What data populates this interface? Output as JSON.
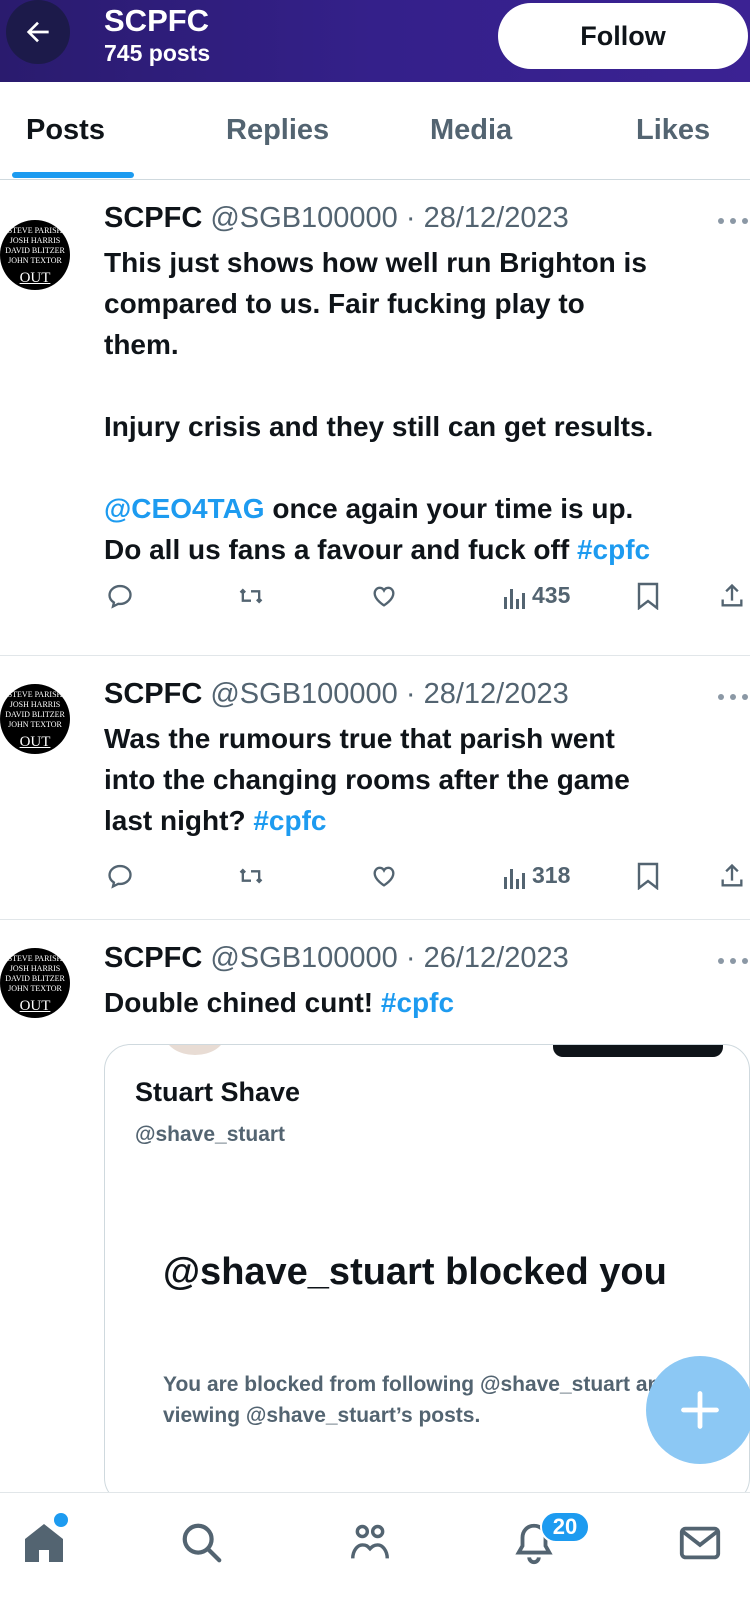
{
  "header": {
    "title": "SCPFC",
    "post_count": "745 posts",
    "follow_label": "Follow"
  },
  "tabs": [
    {
      "label": "Posts",
      "active": true
    },
    {
      "label": "Replies",
      "active": false
    },
    {
      "label": "Media",
      "active": false
    },
    {
      "label": "Likes",
      "active": false
    }
  ],
  "avatar": {
    "names": [
      "STEVE PARISH",
      "JOSH HARRIS",
      "DAVID BLITZER",
      "JOHN TEXTOR"
    ],
    "out": "OUT"
  },
  "tweets": [
    {
      "name": "SCPFC",
      "meta": "@SGB100000 · 28/12/2023",
      "lines": [
        "This just shows how well run Brighton is",
        "compared to us. Fair fucking play to",
        "them.",
        "",
        "Injury crisis and they still can get results.",
        ""
      ],
      "mention": "@CEO4TAG",
      "mention_rest": " once again your time is up.",
      "last_line": "Do all us fans a favour and fuck off ",
      "hashtag": "#cpfc",
      "views": "435"
    },
    {
      "name": "SCPFC",
      "meta": "@SGB100000 · 28/12/2023",
      "lines": [
        "Was the rumours true that parish went",
        "into the changing rooms after the game"
      ],
      "last_line": "last night? ",
      "hashtag": "#cpfc",
      "views": "318"
    },
    {
      "name": "SCPFC",
      "meta": "@SGB100000 · 26/12/2023",
      "last_line": "Double chined cunt! ",
      "hashtag": "#cpfc"
    }
  ],
  "quoted": {
    "name": "Stuart Shave",
    "handle": "@shave_stuart",
    "blocked_title": "@shave_stuart blocked you",
    "blocked_info": "You are blocked from following @shave_stuart and viewing @shave_stuart’s posts."
  },
  "nav": {
    "notifications_badge": "20"
  },
  "colors": {
    "accent": "#1d9bf0",
    "header_bg": "#34208a",
    "muted": "#536471"
  },
  "icons": [
    "back-arrow-icon",
    "more-icon",
    "reply-icon",
    "retweet-icon",
    "like-icon",
    "views-icon",
    "bookmark-icon",
    "share-icon",
    "compose-plus-icon",
    "home-icon",
    "search-icon",
    "communities-icon",
    "bell-icon",
    "mail-icon"
  ]
}
